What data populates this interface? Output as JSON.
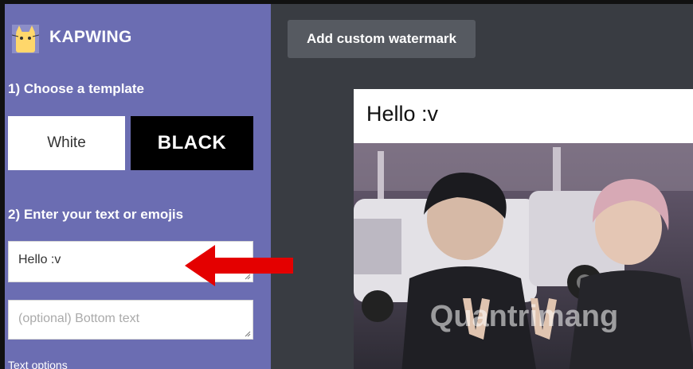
{
  "brand": {
    "name": "KAPWING",
    "logo_icon": "cat-logo-icon"
  },
  "sidebar": {
    "step1_label": "1) Choose a template",
    "templates": [
      {
        "label": "White"
      },
      {
        "label": "BLACK"
      }
    ],
    "step2_label": "2) Enter your text or emojis",
    "top_text_value": "Hello :v",
    "bottom_text_placeholder": "(optional) Bottom text",
    "text_options_label": "Text options"
  },
  "main": {
    "watermark_button": "Add custom watermark",
    "preview_title": "Hello :v",
    "photo_watermark": "Quantrimang"
  },
  "annotation": {
    "icon": "red-arrow-icon",
    "color": "#e40000"
  },
  "colors": {
    "sidebar_bg": "#6b6db2",
    "main_bg": "#393c42",
    "button_bg": "#565a61"
  }
}
